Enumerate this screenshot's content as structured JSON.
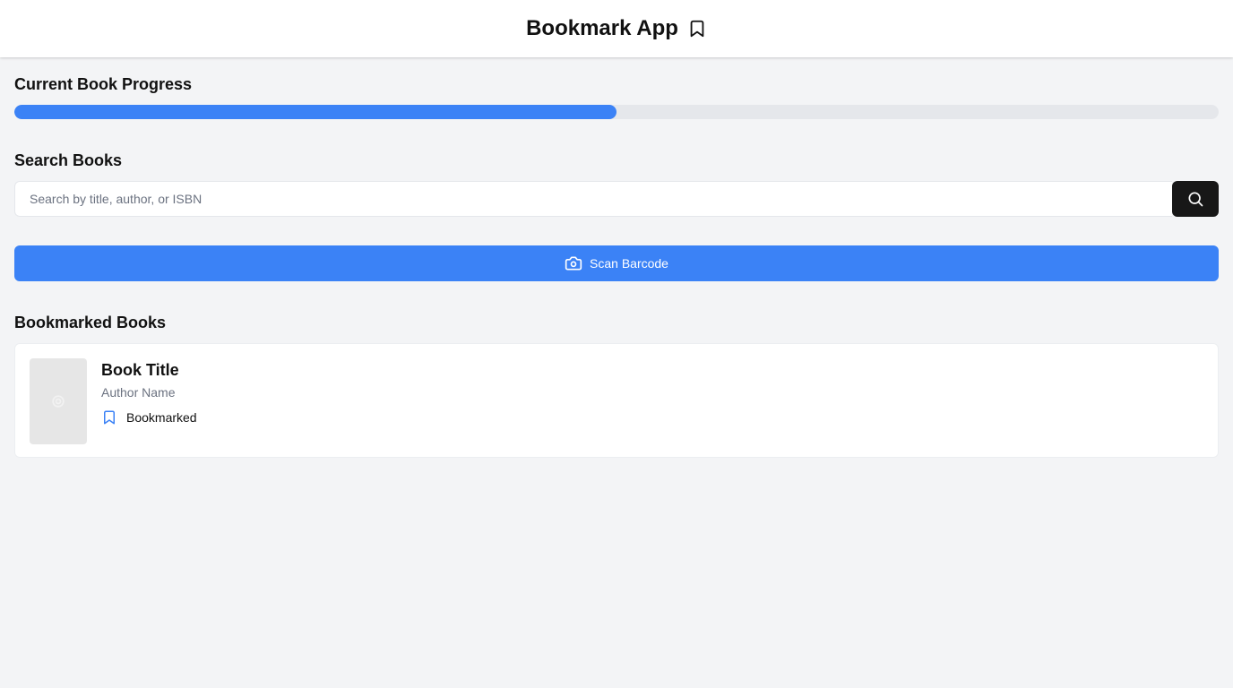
{
  "header": {
    "title": "Bookmark App",
    "icon": "bookmark-icon"
  },
  "progress": {
    "heading": "Current Book Progress",
    "percent": 50,
    "fill_color": "#3b82f6",
    "track_color": "#e5e7eb"
  },
  "search": {
    "heading": "Search Books",
    "placeholder": "Search by title, author, or ISBN",
    "value": "",
    "button_icon": "search-icon"
  },
  "scan": {
    "label": "Scan Barcode",
    "icon": "camera-icon",
    "color": "#3b82f6"
  },
  "bookmarks": {
    "heading": "Bookmarked Books",
    "books": [
      {
        "title": "Book Title",
        "author": "Author Name",
        "status": "Bookmarked",
        "cover_icon": "image-placeholder-icon",
        "status_icon": "bookmark-icon"
      }
    ]
  }
}
